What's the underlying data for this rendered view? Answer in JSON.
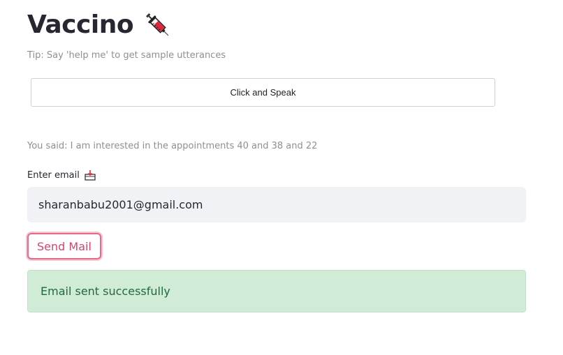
{
  "header": {
    "title": "Vaccino",
    "icon": "syringe-icon"
  },
  "tip": "Tip: Say 'help me' to get sample utterances",
  "speak_button": {
    "label": "Click and Speak"
  },
  "transcript": "You said: I am interested in the appointments 40 and 38 and 22",
  "email": {
    "label": "Enter email",
    "label_icon": "inbox-tray-icon",
    "value": "sharanbabu2001@gmail.com"
  },
  "send_button": {
    "label": "Send Mail",
    "border_color": "#e56b8a"
  },
  "alert": {
    "message": "Email sent successfully",
    "background": "#d0ecd6",
    "text_color": "#1f6b3b"
  }
}
